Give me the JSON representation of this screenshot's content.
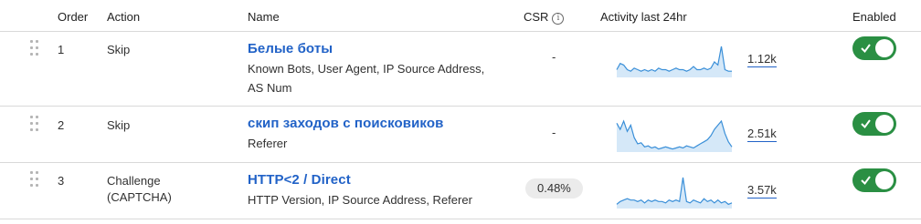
{
  "headers": {
    "order": "Order",
    "action": "Action",
    "name": "Name",
    "csr": "CSR",
    "activity": "Activity last 24hr",
    "enabled": "Enabled"
  },
  "rows": [
    {
      "order": "1",
      "action": "Skip",
      "name": "Белые боты",
      "desc_line1": "Known Bots, User Agent, IP Source Address,",
      "desc_line2": "AS Num",
      "csr": "-",
      "count": "1.12k",
      "enabled": true,
      "activity": [
        0,
        0,
        0,
        0,
        0,
        0,
        0,
        5,
        9,
        8,
        5,
        4,
        6,
        5,
        4,
        5,
        4,
        5,
        4,
        6,
        5,
        5,
        4,
        5,
        6,
        5,
        5,
        4,
        5,
        7,
        5,
        5,
        6,
        5,
        6,
        10,
        8,
        20,
        5,
        4,
        4
      ]
    },
    {
      "order": "2",
      "action": "Skip",
      "name": "скип заходов с поисковиков",
      "desc_line1": "Referer",
      "desc_line2": "",
      "csr": "-",
      "count": "2.51k",
      "enabled": true,
      "activity": [
        0,
        0,
        0,
        0,
        0,
        0,
        0,
        28,
        22,
        30,
        20,
        26,
        14,
        8,
        9,
        5,
        6,
        4,
        5,
        3,
        4,
        5,
        4,
        3,
        4,
        5,
        4,
        6,
        5,
        4,
        6,
        8,
        10,
        12,
        16,
        22,
        26,
        30,
        18,
        10,
        5
      ]
    },
    {
      "order": "3",
      "action": "Challenge",
      "action_line2": "(CAPTCHA)",
      "name": "HTTP<2 / Direct",
      "desc_line1": "HTTP Version, IP Source Address, Referer",
      "desc_line2": "",
      "csr": "0.48%",
      "count": "3.57k",
      "enabled": true,
      "activity": [
        0,
        0,
        0,
        0,
        0,
        0,
        0,
        3,
        5,
        6,
        7,
        6,
        6,
        5,
        6,
        4,
        6,
        5,
        6,
        5,
        5,
        4,
        6,
        5,
        6,
        5,
        22,
        5,
        4,
        6,
        5,
        4,
        7,
        5,
        6,
        4,
        6,
        4,
        5,
        3,
        4
      ]
    }
  ],
  "colors": {
    "link": "#2162c7",
    "toggle_on": "#2a8f43",
    "spark_line": "#3a8fd8",
    "spark_fill": "#d5e8f8"
  }
}
